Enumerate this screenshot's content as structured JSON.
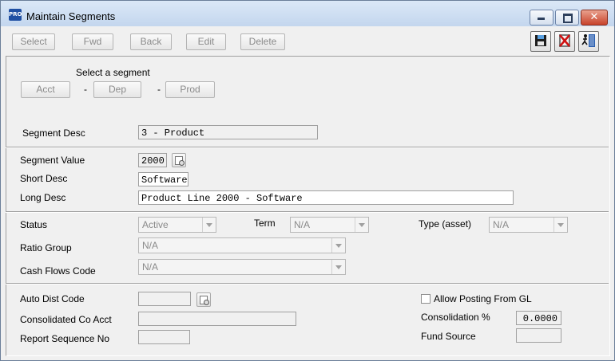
{
  "window": {
    "title": "Maintain Segments",
    "app_icon_text": "PRO"
  },
  "toolbar": {
    "select": "Select",
    "fwd": "Fwd",
    "back": "Back",
    "edit": "Edit",
    "delete": "Delete"
  },
  "segment_select": {
    "caption": "Select a segment",
    "acct": "Acct",
    "dep": "Dep",
    "prod": "Prod",
    "separator": "-"
  },
  "segment_desc": {
    "label": "Segment Desc",
    "value": "3 - Product"
  },
  "values": {
    "segment_value_label": "Segment Value",
    "segment_value": "2000",
    "short_desc_label": "Short Desc",
    "short_desc": "Software",
    "long_desc_label": "Long Desc",
    "long_desc": "Product Line 2000 - Software"
  },
  "classification": {
    "status_label": "Status",
    "status_value": "Active",
    "term_label": "Term",
    "term_value": "N/A",
    "type_label": "Type (asset)",
    "type_value": "N/A",
    "ratio_group_label": "Ratio Group",
    "ratio_group_value": "N/A",
    "cash_flows_label": "Cash Flows Code",
    "cash_flows_value": "N/A"
  },
  "other": {
    "auto_dist_label": "Auto Dist Code",
    "auto_dist_value": "",
    "consolidated_label": "Consolidated Co Acct",
    "consolidated_value": "",
    "report_seq_label": "Report Sequence No",
    "report_seq_value": "",
    "allow_posting_label": "Allow Posting From GL",
    "allow_posting_checked": false,
    "consolidation_pct_label": "Consolidation %",
    "consolidation_pct_value": "0.0000",
    "fund_source_label": "Fund Source",
    "fund_source_value": ""
  }
}
